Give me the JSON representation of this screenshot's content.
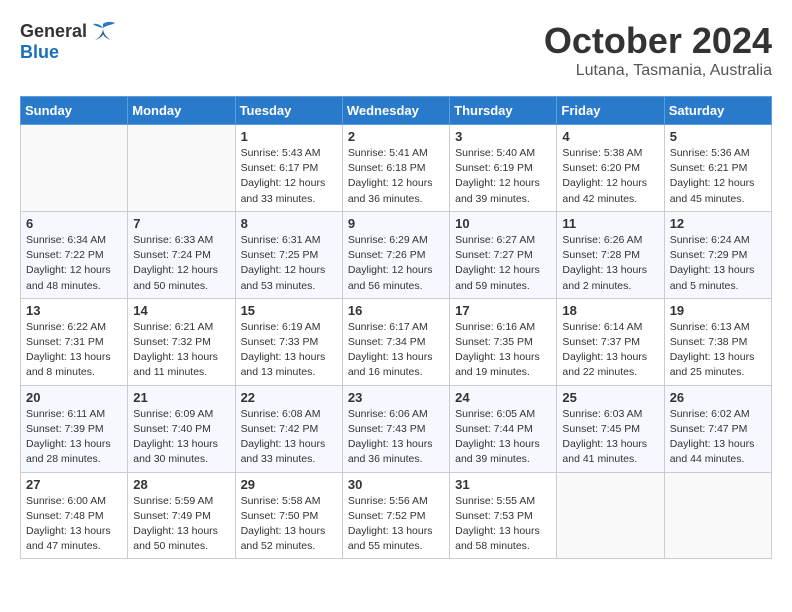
{
  "logo": {
    "general": "General",
    "blue": "Blue"
  },
  "title": "October 2024",
  "location": "Lutana, Tasmania, Australia",
  "weekdays": [
    "Sunday",
    "Monday",
    "Tuesday",
    "Wednesday",
    "Thursday",
    "Friday",
    "Saturday"
  ],
  "weeks": [
    [
      {
        "day": "",
        "info": ""
      },
      {
        "day": "",
        "info": ""
      },
      {
        "day": "1",
        "info": "Sunrise: 5:43 AM\nSunset: 6:17 PM\nDaylight: 12 hours\nand 33 minutes."
      },
      {
        "day": "2",
        "info": "Sunrise: 5:41 AM\nSunset: 6:18 PM\nDaylight: 12 hours\nand 36 minutes."
      },
      {
        "day": "3",
        "info": "Sunrise: 5:40 AM\nSunset: 6:19 PM\nDaylight: 12 hours\nand 39 minutes."
      },
      {
        "day": "4",
        "info": "Sunrise: 5:38 AM\nSunset: 6:20 PM\nDaylight: 12 hours\nand 42 minutes."
      },
      {
        "day": "5",
        "info": "Sunrise: 5:36 AM\nSunset: 6:21 PM\nDaylight: 12 hours\nand 45 minutes."
      }
    ],
    [
      {
        "day": "6",
        "info": "Sunrise: 6:34 AM\nSunset: 7:22 PM\nDaylight: 12 hours\nand 48 minutes."
      },
      {
        "day": "7",
        "info": "Sunrise: 6:33 AM\nSunset: 7:24 PM\nDaylight: 12 hours\nand 50 minutes."
      },
      {
        "day": "8",
        "info": "Sunrise: 6:31 AM\nSunset: 7:25 PM\nDaylight: 12 hours\nand 53 minutes."
      },
      {
        "day": "9",
        "info": "Sunrise: 6:29 AM\nSunset: 7:26 PM\nDaylight: 12 hours\nand 56 minutes."
      },
      {
        "day": "10",
        "info": "Sunrise: 6:27 AM\nSunset: 7:27 PM\nDaylight: 12 hours\nand 59 minutes."
      },
      {
        "day": "11",
        "info": "Sunrise: 6:26 AM\nSunset: 7:28 PM\nDaylight: 13 hours\nand 2 minutes."
      },
      {
        "day": "12",
        "info": "Sunrise: 6:24 AM\nSunset: 7:29 PM\nDaylight: 13 hours\nand 5 minutes."
      }
    ],
    [
      {
        "day": "13",
        "info": "Sunrise: 6:22 AM\nSunset: 7:31 PM\nDaylight: 13 hours\nand 8 minutes."
      },
      {
        "day": "14",
        "info": "Sunrise: 6:21 AM\nSunset: 7:32 PM\nDaylight: 13 hours\nand 11 minutes."
      },
      {
        "day": "15",
        "info": "Sunrise: 6:19 AM\nSunset: 7:33 PM\nDaylight: 13 hours\nand 13 minutes."
      },
      {
        "day": "16",
        "info": "Sunrise: 6:17 AM\nSunset: 7:34 PM\nDaylight: 13 hours\nand 16 minutes."
      },
      {
        "day": "17",
        "info": "Sunrise: 6:16 AM\nSunset: 7:35 PM\nDaylight: 13 hours\nand 19 minutes."
      },
      {
        "day": "18",
        "info": "Sunrise: 6:14 AM\nSunset: 7:37 PM\nDaylight: 13 hours\nand 22 minutes."
      },
      {
        "day": "19",
        "info": "Sunrise: 6:13 AM\nSunset: 7:38 PM\nDaylight: 13 hours\nand 25 minutes."
      }
    ],
    [
      {
        "day": "20",
        "info": "Sunrise: 6:11 AM\nSunset: 7:39 PM\nDaylight: 13 hours\nand 28 minutes."
      },
      {
        "day": "21",
        "info": "Sunrise: 6:09 AM\nSunset: 7:40 PM\nDaylight: 13 hours\nand 30 minutes."
      },
      {
        "day": "22",
        "info": "Sunrise: 6:08 AM\nSunset: 7:42 PM\nDaylight: 13 hours\nand 33 minutes."
      },
      {
        "day": "23",
        "info": "Sunrise: 6:06 AM\nSunset: 7:43 PM\nDaylight: 13 hours\nand 36 minutes."
      },
      {
        "day": "24",
        "info": "Sunrise: 6:05 AM\nSunset: 7:44 PM\nDaylight: 13 hours\nand 39 minutes."
      },
      {
        "day": "25",
        "info": "Sunrise: 6:03 AM\nSunset: 7:45 PM\nDaylight: 13 hours\nand 41 minutes."
      },
      {
        "day": "26",
        "info": "Sunrise: 6:02 AM\nSunset: 7:47 PM\nDaylight: 13 hours\nand 44 minutes."
      }
    ],
    [
      {
        "day": "27",
        "info": "Sunrise: 6:00 AM\nSunset: 7:48 PM\nDaylight: 13 hours\nand 47 minutes."
      },
      {
        "day": "28",
        "info": "Sunrise: 5:59 AM\nSunset: 7:49 PM\nDaylight: 13 hours\nand 50 minutes."
      },
      {
        "day": "29",
        "info": "Sunrise: 5:58 AM\nSunset: 7:50 PM\nDaylight: 13 hours\nand 52 minutes."
      },
      {
        "day": "30",
        "info": "Sunrise: 5:56 AM\nSunset: 7:52 PM\nDaylight: 13 hours\nand 55 minutes."
      },
      {
        "day": "31",
        "info": "Sunrise: 5:55 AM\nSunset: 7:53 PM\nDaylight: 13 hours\nand 58 minutes."
      },
      {
        "day": "",
        "info": ""
      },
      {
        "day": "",
        "info": ""
      }
    ]
  ]
}
